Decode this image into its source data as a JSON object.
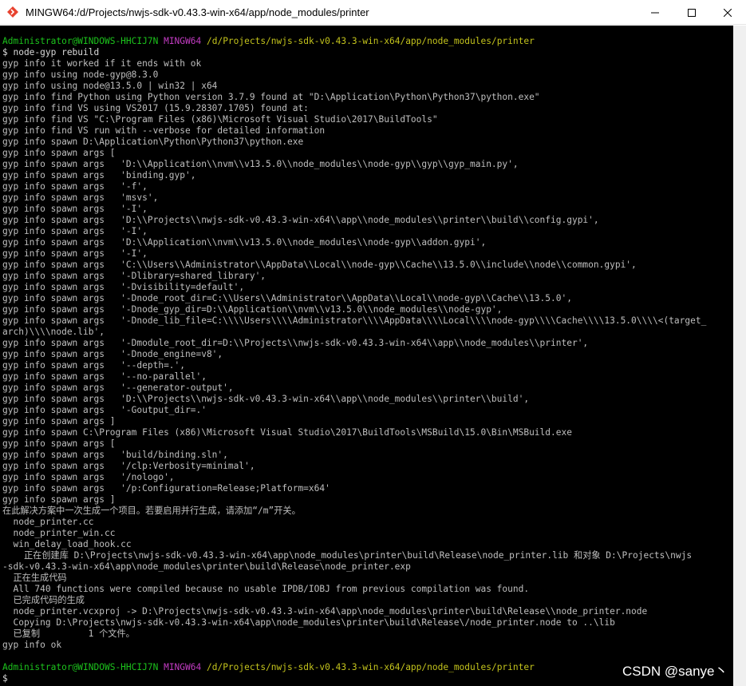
{
  "window": {
    "title": "MINGW64:/d/Projects/nwjs-sdk-v0.43.3-win-x64/app/node_modules/printer"
  },
  "prompt": {
    "user": "Administrator@WINDOWS-HHCIJ7N",
    "shell": "MINGW64",
    "path": "/d/Projects/nwjs-sdk-v0.43.3-win-x64/app/node_modules/printer",
    "symbol": "$"
  },
  "command": "$ node-gyp rebuild",
  "output": [
    "gyp info it worked if it ends with ok",
    "gyp info using node-gyp@8.3.0",
    "gyp info using node@13.5.0 | win32 | x64",
    "gyp info find Python using Python version 3.7.9 found at \"D:\\Application\\Python\\Python37\\python.exe\"",
    "gyp info find VS using VS2017 (15.9.28307.1705) found at:",
    "gyp info find VS \"C:\\Program Files (x86)\\Microsoft Visual Studio\\2017\\BuildTools\"",
    "gyp info find VS run with --verbose for detailed information",
    "gyp info spawn D:\\Application\\Python\\Python37\\python.exe",
    "gyp info spawn args [",
    "gyp info spawn args   'D:\\\\Application\\\\nvm\\\\v13.5.0\\\\node_modules\\\\node-gyp\\\\gyp\\\\gyp_main.py',",
    "gyp info spawn args   'binding.gyp',",
    "gyp info spawn args   '-f',",
    "gyp info spawn args   'msvs',",
    "gyp info spawn args   '-I',",
    "gyp info spawn args   'D:\\\\Projects\\\\nwjs-sdk-v0.43.3-win-x64\\\\app\\\\node_modules\\\\printer\\\\build\\\\config.gypi',",
    "gyp info spawn args   '-I',",
    "gyp info spawn args   'D:\\\\Application\\\\nvm\\\\v13.5.0\\\\node_modules\\\\node-gyp\\\\addon.gypi',",
    "gyp info spawn args   '-I',",
    "gyp info spawn args   'C:\\\\Users\\\\Administrator\\\\AppData\\\\Local\\\\node-gyp\\\\Cache\\\\13.5.0\\\\include\\\\node\\\\common.gypi',",
    "gyp info spawn args   '-Dlibrary=shared_library',",
    "gyp info spawn args   '-Dvisibility=default',",
    "gyp info spawn args   '-Dnode_root_dir=C:\\\\Users\\\\Administrator\\\\AppData\\\\Local\\\\node-gyp\\\\Cache\\\\13.5.0',",
    "gyp info spawn args   '-Dnode_gyp_dir=D:\\\\Application\\\\nvm\\\\v13.5.0\\\\node_modules\\\\node-gyp',",
    "gyp info spawn args   '-Dnode_lib_file=C:\\\\\\\\Users\\\\\\\\Administrator\\\\\\\\AppData\\\\\\\\Local\\\\\\\\node-gyp\\\\\\\\Cache\\\\\\\\13.5.0\\\\\\\\<(target_",
    "arch)\\\\\\\\node.lib',",
    "gyp info spawn args   '-Dmodule_root_dir=D:\\\\Projects\\\\nwjs-sdk-v0.43.3-win-x64\\\\app\\\\node_modules\\\\printer',",
    "gyp info spawn args   '-Dnode_engine=v8',",
    "gyp info spawn args   '--depth=.',",
    "gyp info spawn args   '--no-parallel',",
    "gyp info spawn args   '--generator-output',",
    "gyp info spawn args   'D:\\\\Projects\\\\nwjs-sdk-v0.43.3-win-x64\\\\app\\\\node_modules\\\\printer\\\\build',",
    "gyp info spawn args   '-Goutput_dir=.'",
    "gyp info spawn args ]",
    "gyp info spawn C:\\Program Files (x86)\\Microsoft Visual Studio\\2017\\BuildTools\\MSBuild\\15.0\\Bin\\MSBuild.exe",
    "gyp info spawn args [",
    "gyp info spawn args   'build/binding.sln',",
    "gyp info spawn args   '/clp:Verbosity=minimal',",
    "gyp info spawn args   '/nologo',",
    "gyp info spawn args   '/p:Configuration=Release;Platform=x64'",
    "gyp info spawn args ]",
    "在此解决方案中一次生成一个项目。若要启用并行生成，请添加“/m”开关。",
    "  node_printer.cc",
    "  node_printer_win.cc",
    "  win_delay_load_hook.cc",
    "    正在创建库 D:\\Projects\\nwjs-sdk-v0.43.3-win-x64\\app\\node_modules\\printer\\build\\Release\\node_printer.lib 和对象 D:\\Projects\\nwjs",
    "-sdk-v0.43.3-win-x64\\app\\node_modules\\printer\\build\\Release\\node_printer.exp",
    "  正在生成代码",
    "  All 740 functions were compiled because no usable IPDB/IOBJ from previous compilation was found.",
    "  已完成代码的生成",
    "  node_printer.vcxproj -> D:\\Projects\\nwjs-sdk-v0.43.3-win-x64\\app\\node_modules\\printer\\build\\Release\\\\node_printer.node",
    "  Copying D:\\Projects\\nwjs-sdk-v0.43.3-win-x64\\app\\node_modules\\printer\\build\\Release\\/node_printer.node to ..\\lib",
    "  已复制         1 个文件。",
    "gyp info ok"
  ],
  "final_prompt_symbol": "$",
  "watermark": "CSDN @sanye丶",
  "colors": {
    "user": "#1cc31c",
    "shell": "#c33cc3",
    "path": "#c3c31c",
    "text": "#bfbfbf",
    "background": "#000000"
  }
}
